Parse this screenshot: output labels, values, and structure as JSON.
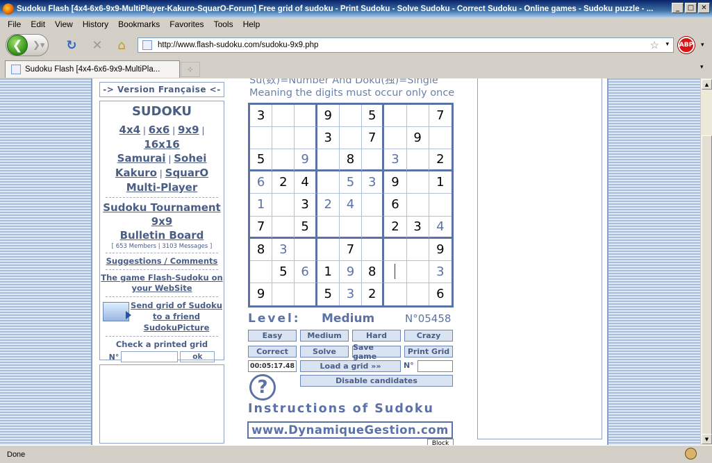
{
  "window": {
    "title": "Sudoku Flash [4x4-6x6-9x9-MultiPlayer-Kakuro-SquarO-Forum] Free grid of sudoku - Print Sudoku - Solve Sudoku - Correct Sudoku - Online games - Sudoku puzzle - ..."
  },
  "menu": [
    "File",
    "Edit",
    "View",
    "History",
    "Bookmarks",
    "Favorites",
    "Tools",
    "Help"
  ],
  "address": {
    "url": "http://www.flash-sudoku.com/sudoku-9x9.php"
  },
  "tab": {
    "label": "Sudoku Flash [4x4-6x6-9x9-MultiPla..."
  },
  "status": {
    "text": "Done"
  },
  "left": {
    "version_link": "-> Version Française <-",
    "heading": "SUDOKU",
    "sizes": [
      "4x4",
      "6x6",
      "9x9",
      "16x16"
    ],
    "variants1": [
      "Samurai",
      "Sohei"
    ],
    "variants2": [
      "Kakuro",
      "SquarO"
    ],
    "multiplayer": "Multi-Player",
    "tournament_line1": "Sudoku Tournament",
    "tournament_line2": "9x9",
    "bulletin": "Bulletin Board",
    "members": "[ 653 Members | 3103 Messages ]",
    "suggestions": "Suggestions / Comments",
    "website_line1": "The game Flash-Sudoku on",
    "website_line2": "your WebSite",
    "send_line1": "Send grid of Sudoku",
    "send_line2": "to a friend",
    "send_line3": "SudokuPicture",
    "check_printed": "Check a printed grid",
    "n_label": "N°",
    "ok_label": "ok"
  },
  "center": {
    "intro_line1": "Su(数)=Number And Doku(独)=Single",
    "intro_line2": "Meaning the digits must occur only once",
    "level_label": "Level:",
    "level_value": "Medium",
    "grid_number": "N°05458",
    "buttons_row1": [
      "Easy",
      "Medium",
      "Hard",
      "Crazy"
    ],
    "buttons_row2": [
      "Correct",
      "Solve",
      "Save game",
      "Print Grid"
    ],
    "timer": "00:05:17.48",
    "load_grid": "Load a grid »»",
    "n_label": "N°",
    "disable_candidates": "Disable candidates",
    "help_symbol": "?",
    "instructions": "Instructions of Sudoku",
    "dg_link": "www.DynamiqueGestion.com",
    "block_label": "Block"
  },
  "grid": [
    [
      "3g",
      "",
      "",
      "9g",
      "",
      "5g",
      "",
      "",
      "7g"
    ],
    [
      "",
      "",
      "",
      "3g",
      "",
      "7g",
      "",
      "9g",
      ""
    ],
    [
      "5g",
      "",
      "9u",
      "",
      "8g",
      "",
      "3u",
      "",
      "2g"
    ],
    [
      "6u",
      "2g",
      "4g",
      "",
      "5u",
      "3u",
      "9g",
      "",
      "1g"
    ],
    [
      "1u",
      "",
      "3g",
      "2u",
      "4u",
      "",
      "6g",
      "",
      ""
    ],
    [
      "7g",
      "",
      "5g",
      "",
      "",
      "",
      "2g",
      "3g",
      "4u"
    ],
    [
      "8g",
      "3u",
      "",
      "",
      "7g",
      "",
      "",
      "",
      "9g"
    ],
    [
      "",
      "5g",
      "6u",
      "1g",
      "9u",
      "8g",
      "|",
      "",
      "3u"
    ],
    [
      "9g",
      "",
      "",
      "5g",
      "3u",
      "2g",
      "",
      "",
      "6g"
    ]
  ],
  "colors": {
    "accent": "#5a72a6",
    "given": "#000000",
    "user": "#5a72a6"
  }
}
